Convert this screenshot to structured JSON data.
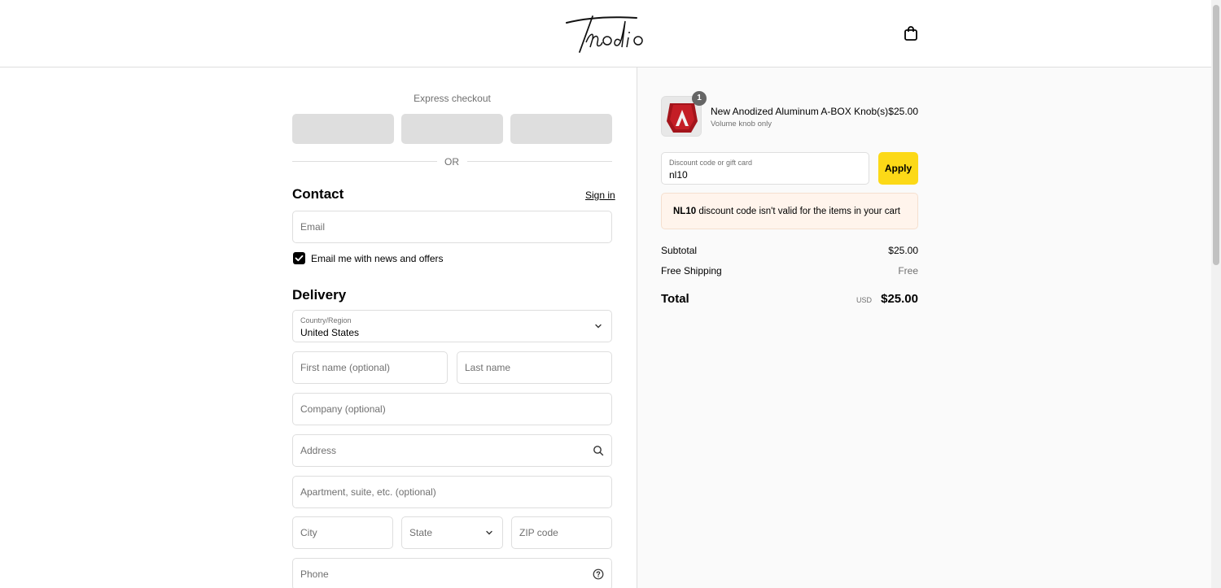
{
  "header": {
    "logo_alt": "Thodio",
    "cart_icon": "shopping-bag-icon"
  },
  "express": {
    "title": "Express checkout",
    "or_label": "OR"
  },
  "contact": {
    "title": "Contact",
    "signin_label": "Sign in",
    "email_placeholder": "Email",
    "newsletter_label": "Email me with news and offers",
    "newsletter_checked": true
  },
  "delivery": {
    "title": "Delivery",
    "country_label": "Country/Region",
    "country_value": "United States",
    "first_name_placeholder": "First name (optional)",
    "last_name_placeholder": "Last name",
    "company_placeholder": "Company (optional)",
    "address_placeholder": "Address",
    "apartment_placeholder": "Apartment, suite, etc. (optional)",
    "city_placeholder": "City",
    "state_placeholder": "State",
    "zip_placeholder": "ZIP code",
    "phone_placeholder": "Phone"
  },
  "summary": {
    "item": {
      "quantity": "1",
      "name": "New Anodized Aluminum A-BOX Knob(s)",
      "variant": "Volume knob only",
      "price": "$25.00"
    },
    "discount": {
      "label": "Discount code or gift card",
      "value": "nl10",
      "apply_label": "Apply"
    },
    "error": {
      "code": "NL10",
      "message": " discount code isn't valid for the items in your cart"
    },
    "subtotal_label": "Subtotal",
    "subtotal_value": "$25.00",
    "shipping_label": "Free Shipping",
    "shipping_value": "Free",
    "total_label": "Total",
    "total_currency": "USD",
    "total_value": "$25.00"
  },
  "colors": {
    "accent_button": "#fcd917",
    "error_bg": "#fff4ec",
    "border": "#dedede"
  }
}
